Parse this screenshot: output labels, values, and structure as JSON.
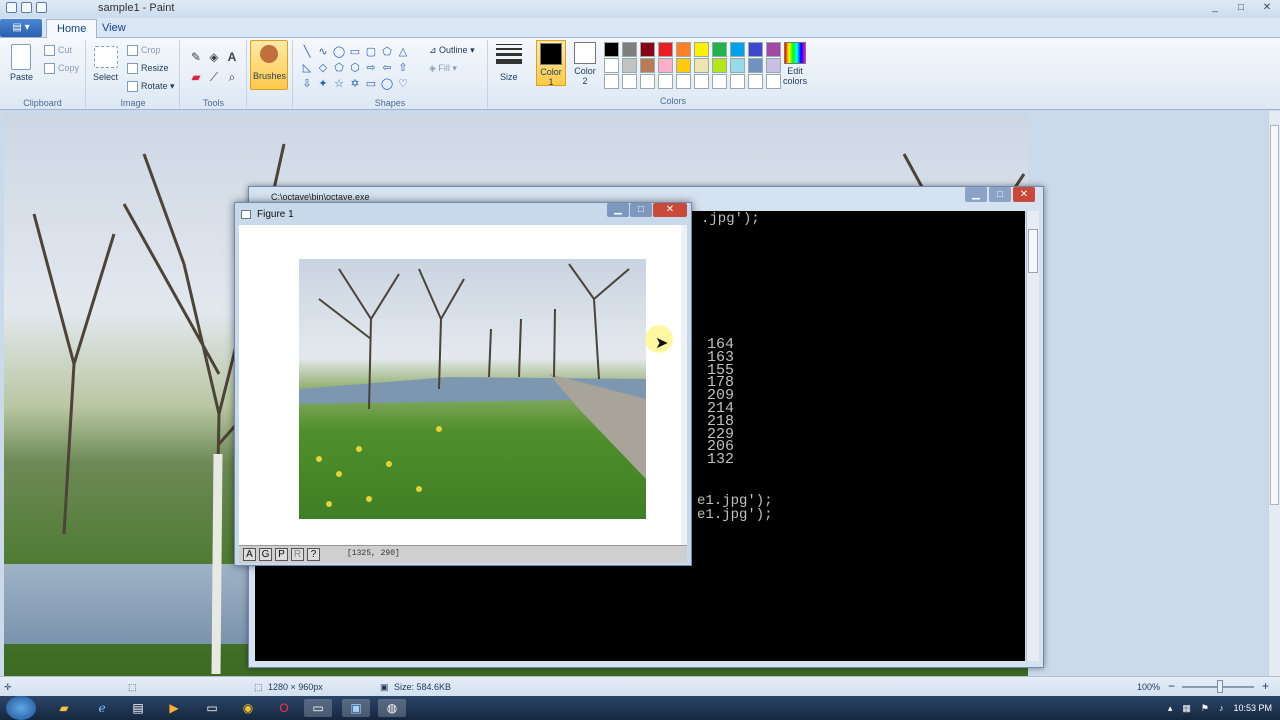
{
  "window": {
    "title": "sample1 - Paint",
    "controls": [
      "_",
      "□",
      "✕"
    ]
  },
  "ribbon_tabs": [
    {
      "label": "Home"
    },
    {
      "label": "View"
    }
  ],
  "clipboard": {
    "paste": "Paste",
    "cut": "Cut",
    "copy": "Copy",
    "group": "Clipboard"
  },
  "image": {
    "select": "Select",
    "crop": "Crop",
    "resize": "Resize",
    "rotate": "Rotate",
    "group": "Image"
  },
  "tools": {
    "group": "Tools",
    "text_tool": "A"
  },
  "brushes": {
    "label": "Brushes"
  },
  "shapes": {
    "outline": "Outline",
    "fill": "Fill",
    "group": "Shapes"
  },
  "size": {
    "label": "Size"
  },
  "colors": {
    "color1_label": "Color",
    "color1_num": "1",
    "color2_label": "Color",
    "color2_num": "2",
    "edit_label": "Edit",
    "edit_label2": "colors",
    "group": "Colors",
    "palette": [
      "#000000",
      "#7f7f7f",
      "#880015",
      "#ed1c24",
      "#ff7f27",
      "#fff200",
      "#22b14c",
      "#00a2e8",
      "#3f48cc",
      "#a349a4",
      "#ffffff",
      "#c3c3c3",
      "#b97a57",
      "#ffaec9",
      "#ffc90e",
      "#efe4b0",
      "#b5e61d",
      "#99d9ea",
      "#7092be",
      "#c8bfe7",
      "#ffffff",
      "#ffffff",
      "#ffffff",
      "#ffffff",
      "#ffffff",
      "#ffffff",
      "#ffffff",
      "#ffffff",
      "#ffffff",
      "#ffffff"
    ]
  },
  "console": {
    "title": "C:\\octave\\bin\\octave.exe",
    "line1": ".jpg');",
    "numbers": [
      "164",
      "163",
      "155",
      "178",
      "209",
      "214",
      "218",
      "229",
      "206",
      "132"
    ],
    "line2": "e1.jpg');",
    "line3": "e1.jpg');"
  },
  "figure": {
    "title": "Figure 1",
    "buttons": [
      "A",
      "G",
      "P",
      "R",
      "?"
    ],
    "coord": "[1325, 290]"
  },
  "statusbar": {
    "dimensions": "1280 × 960px",
    "size": "Size: 584.6KB",
    "zoom": "100%",
    "zoom_minus": "−",
    "zoom_plus": "+"
  },
  "taskbar": {
    "time": "10:53 PM"
  }
}
